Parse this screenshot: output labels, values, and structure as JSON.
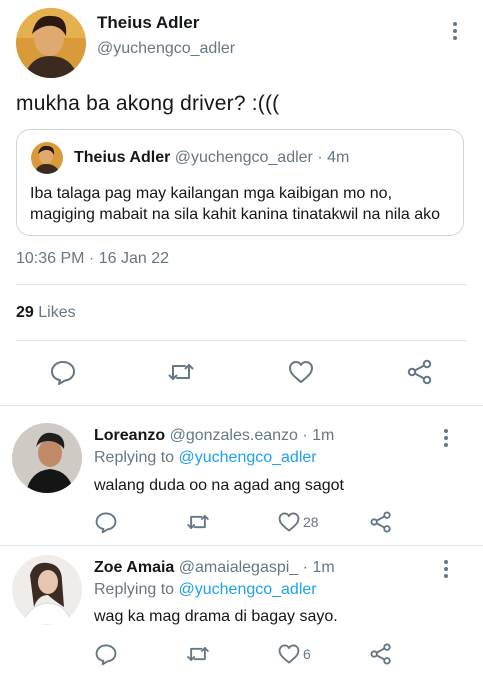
{
  "main_tweet": {
    "author_name": "Theius Adler",
    "author_handle": "@yuchengco_adler",
    "text": "mukha ba akong driver? :(((",
    "timestamp": "10:36 PM · 16 Jan 22",
    "likes_count": "29",
    "likes_label": "Likes"
  },
  "quoted_tweet": {
    "author_name": "Theius Adler",
    "author_handle": "@yuchengco_adler · 4m",
    "text": "Iba talaga pag may kailangan mga kaibigan mo no, magiging mabait na sila kahit kanina tinatakwil na nila ako"
  },
  "replies": [
    {
      "author_name": "Loreanzo",
      "author_handle": "@gonzales.eanzo · 1m",
      "replying_prefix": "Replying to",
      "replying_to": "@yuchengco_adler",
      "text": "walang duda oo na agad ang sagot",
      "like_count": "28"
    },
    {
      "author_name": "Zoe Amaia",
      "author_handle": "@amaialegaspi_ · 1m",
      "replying_prefix": "Replying to",
      "replying_to": "@yuchengco_adler",
      "text": "wag ka mag drama di bagay sayo.",
      "like_count": "6"
    }
  ],
  "icons": {
    "reply": "reply-icon",
    "retweet": "retweet-icon",
    "like": "like-icon",
    "share": "share-icon",
    "more": "more-icon"
  },
  "colors": {
    "text_primary": "#14171a",
    "text_secondary": "#657786",
    "link": "#1da1f2",
    "divider": "#e1e8ed"
  }
}
